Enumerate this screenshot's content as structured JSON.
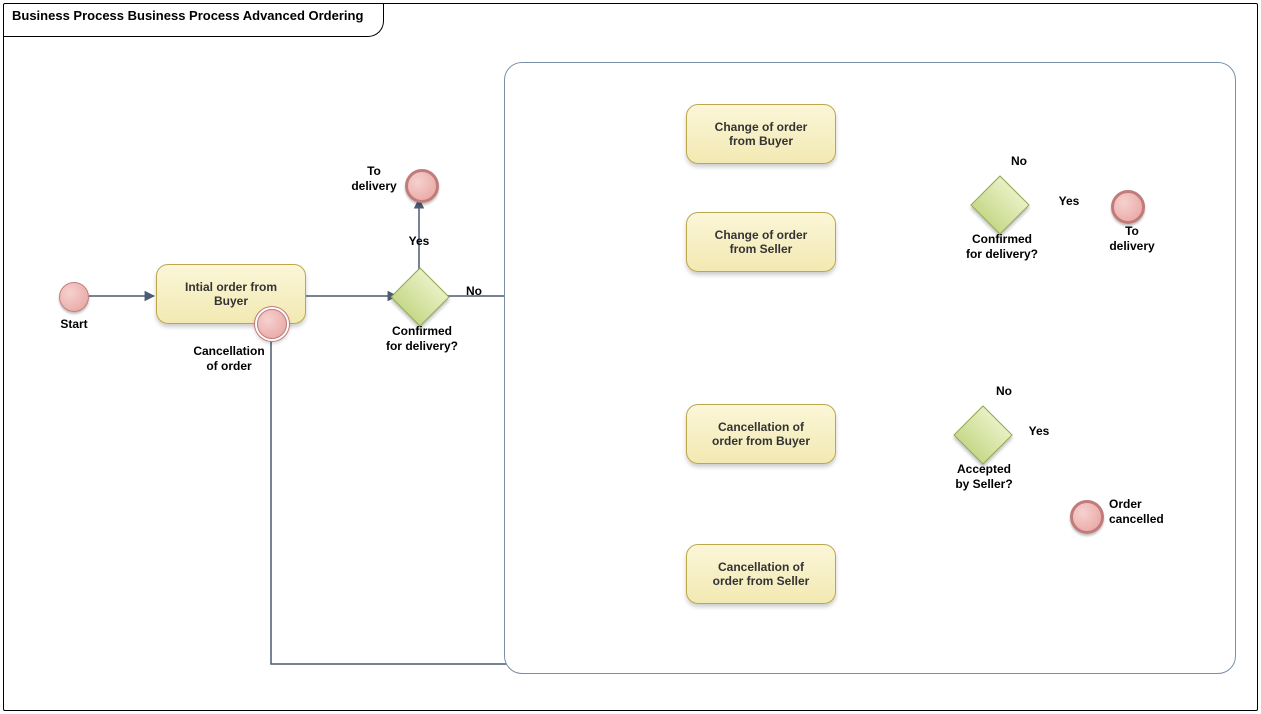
{
  "title": "Business Process Business Process Advanced Ordering",
  "labels": {
    "start": "Start",
    "cancellation_attached": "Cancellation\nof order",
    "to_delivery_left": "To\ndelivery",
    "confirmed_left": "Confirmed\nfor delivery?",
    "yes_left": "Yes",
    "no_left": "No",
    "confirmed_right": "Confirmed\nfor delivery?",
    "yes_right": "Yes",
    "no_right": "No",
    "to_delivery_right": "To\ndelivery",
    "accepted_by_seller": "Accepted\nby Seller?",
    "yes_accept": "Yes",
    "no_accept": "No",
    "order_cancelled": "Order\ncancelled"
  },
  "tasks": {
    "initial_order": "Intial order from\nBuyer",
    "change_buyer": "Change of order\nfrom Buyer",
    "change_seller": "Change of order\nfrom Seller",
    "cancel_buyer": "Cancellation of\norder from Buyer",
    "cancel_seller": "Cancellation of\norder from Seller"
  },
  "chart_data": {
    "type": "bpmn-flow",
    "nodes": [
      {
        "id": "start",
        "kind": "start-event",
        "label": "Start"
      },
      {
        "id": "initial_order",
        "kind": "task",
        "label": "Intial order from Buyer",
        "boundary": [
          {
            "id": "cancel_boundary",
            "kind": "cancel-boundary",
            "label": "Cancellation of order"
          }
        ]
      },
      {
        "id": "gw_confirm_1",
        "kind": "exclusive-gateway",
        "label": "Confirmed for delivery?"
      },
      {
        "id": "end_delivery_1",
        "kind": "end-event",
        "label": "To delivery"
      },
      {
        "id": "gw_complex",
        "kind": "complex-gateway"
      },
      {
        "id": "subprocess",
        "kind": "expanded-subprocess",
        "children": [
          "change_buyer",
          "change_seller",
          "cancel_buyer",
          "cancel_seller",
          "gw_confirm_2",
          "end_delivery_2",
          "gw_accept",
          "end_cancelled"
        ]
      },
      {
        "id": "change_buyer",
        "kind": "task",
        "label": "Change of order from Buyer"
      },
      {
        "id": "change_seller",
        "kind": "task",
        "label": "Change of order from Seller"
      },
      {
        "id": "cancel_buyer",
        "kind": "task",
        "label": "Cancellation of order from Buyer"
      },
      {
        "id": "cancel_seller",
        "kind": "task",
        "label": "Cancellation of order from Seller"
      },
      {
        "id": "gw_confirm_2",
        "kind": "exclusive-gateway",
        "label": "Confirmed for delivery?"
      },
      {
        "id": "end_delivery_2",
        "kind": "end-event",
        "label": "To delivery"
      },
      {
        "id": "gw_accept",
        "kind": "exclusive-gateway",
        "label": "Accepted by Seller?"
      },
      {
        "id": "end_cancelled",
        "kind": "end-event",
        "label": "Order cancelled"
      }
    ],
    "flows": [
      {
        "from": "start",
        "to": "initial_order"
      },
      {
        "from": "initial_order",
        "to": "gw_confirm_1"
      },
      {
        "from": "gw_confirm_1",
        "to": "end_delivery_1",
        "label": "Yes"
      },
      {
        "from": "gw_confirm_1",
        "to": "gw_complex",
        "label": "No"
      },
      {
        "from": "gw_complex",
        "to": "change_buyer"
      },
      {
        "from": "gw_complex",
        "to": "change_seller"
      },
      {
        "from": "gw_complex",
        "to": "cancel_buyer"
      },
      {
        "from": "gw_complex",
        "to": "cancel_seller"
      },
      {
        "from": "change_buyer",
        "to": "gw_confirm_2"
      },
      {
        "from": "change_seller",
        "to": "gw_confirm_2"
      },
      {
        "from": "gw_confirm_2",
        "to": "end_delivery_2",
        "label": "Yes"
      },
      {
        "from": "gw_confirm_2",
        "to": "gw_complex",
        "label": "No"
      },
      {
        "from": "cancel_buyer",
        "to": "gw_accept"
      },
      {
        "from": "gw_accept",
        "to": "end_cancelled",
        "label": "Yes"
      },
      {
        "from": "gw_accept",
        "to": "gw_complex",
        "label": "No"
      },
      {
        "from": "cancel_seller",
        "to": "end_cancelled"
      },
      {
        "from": "cancel_boundary",
        "to": "gw_complex"
      }
    ]
  }
}
